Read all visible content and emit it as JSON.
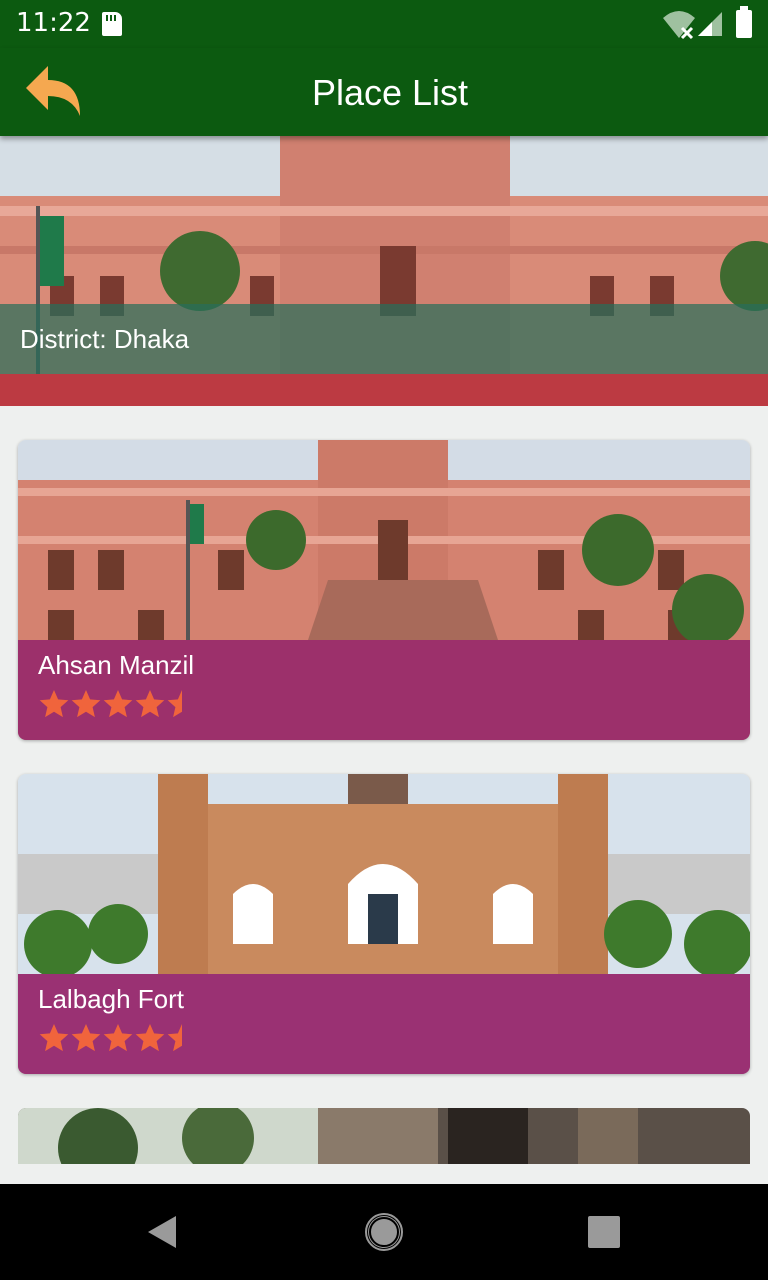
{
  "status_bar": {
    "time": "11:22"
  },
  "app_bar": {
    "title": "Place List"
  },
  "district": {
    "label": "District: Dhaka"
  },
  "places": [
    {
      "name": "Ahsan Manzil",
      "rating": 4.5
    },
    {
      "name": "Lalbagh Fort",
      "rating": 4.5
    }
  ],
  "colors": {
    "primary": "#0c5a10",
    "back_arrow": "#f5a850",
    "district_strip": "#bc3a42",
    "card_overlay": "#91196e",
    "star": "#f0643c"
  },
  "icons": [
    "sd-card-icon",
    "wifi-icon",
    "signal-icon",
    "battery-icon",
    "back-arrow-icon",
    "star-icon"
  ]
}
